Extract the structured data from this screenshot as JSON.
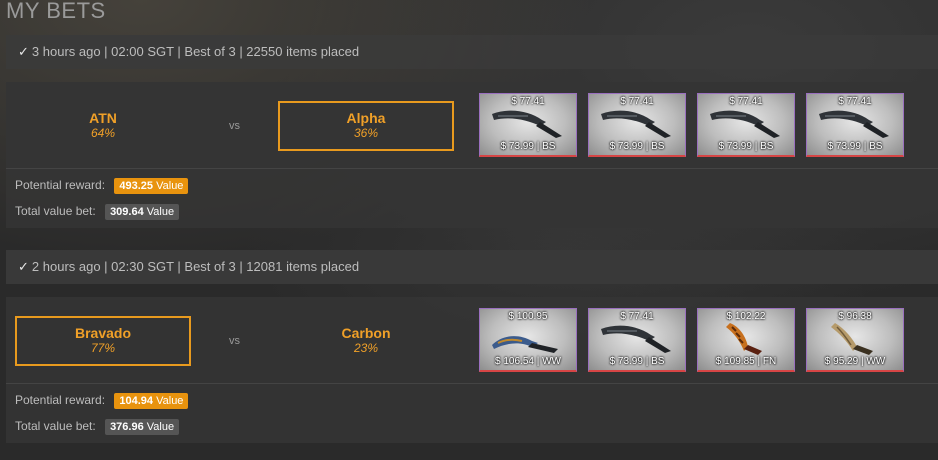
{
  "page": {
    "title": "MY BETS"
  },
  "bets": [
    {
      "header": "3 hours ago | 02:00 SGT | Best of 3 | 22550 items placed",
      "team_left": {
        "name": "ATN",
        "pct": "64%"
      },
      "team_right": {
        "name": "Alpha",
        "pct": "36%"
      },
      "vs": "vs",
      "selected": "right",
      "items": [
        {
          "top": "$ 77.41",
          "bottom": "$ 73.99 | BS",
          "skin": "night"
        },
        {
          "top": "$ 77.41",
          "bottom": "$ 73.99 | BS",
          "skin": "night"
        },
        {
          "top": "$ 77.41",
          "bottom": "$ 73.99 | BS",
          "skin": "night"
        },
        {
          "top": "$ 77.41",
          "bottom": "$ 73.99 | BS",
          "skin": "night"
        }
      ],
      "potential_reward_label": "Potential reward:",
      "potential_reward_value": "493.25",
      "total_bet_label": "Total value bet:",
      "total_bet_value": "309.64",
      "value_word": "Value"
    },
    {
      "header": "2 hours ago | 02:30 SGT | Best of 3 | 12081 items placed",
      "team_left": {
        "name": "Bravado",
        "pct": "77%"
      },
      "team_right": {
        "name": "Carbon",
        "pct": "23%"
      },
      "vs": "vs",
      "selected": "left",
      "items": [
        {
          "top": "$ 100.95",
          "bottom": "$ 106.54 | WW",
          "skin": "case-hardened"
        },
        {
          "top": "$ 77.41",
          "bottom": "$ 73.99 | BS",
          "skin": "night"
        },
        {
          "top": "$ 102.22",
          "bottom": "$ 109.85 | FN",
          "skin": "tiger"
        },
        {
          "top": "$ 96.38",
          "bottom": "$ 95.29 | WW",
          "skin": "stained"
        }
      ],
      "potential_reward_label": "Potential reward:",
      "potential_reward_value": "104.94",
      "total_bet_label": "Total value bet:",
      "total_bet_value": "376.96",
      "value_word": "Value"
    }
  ],
  "colors": {
    "accent": "#e8930e",
    "team_text": "#f0a028",
    "item_border": "#9a6fbf",
    "item_underline": "#d64545"
  },
  "icons": {
    "check": "✓",
    "item_image": "knife-icon"
  }
}
